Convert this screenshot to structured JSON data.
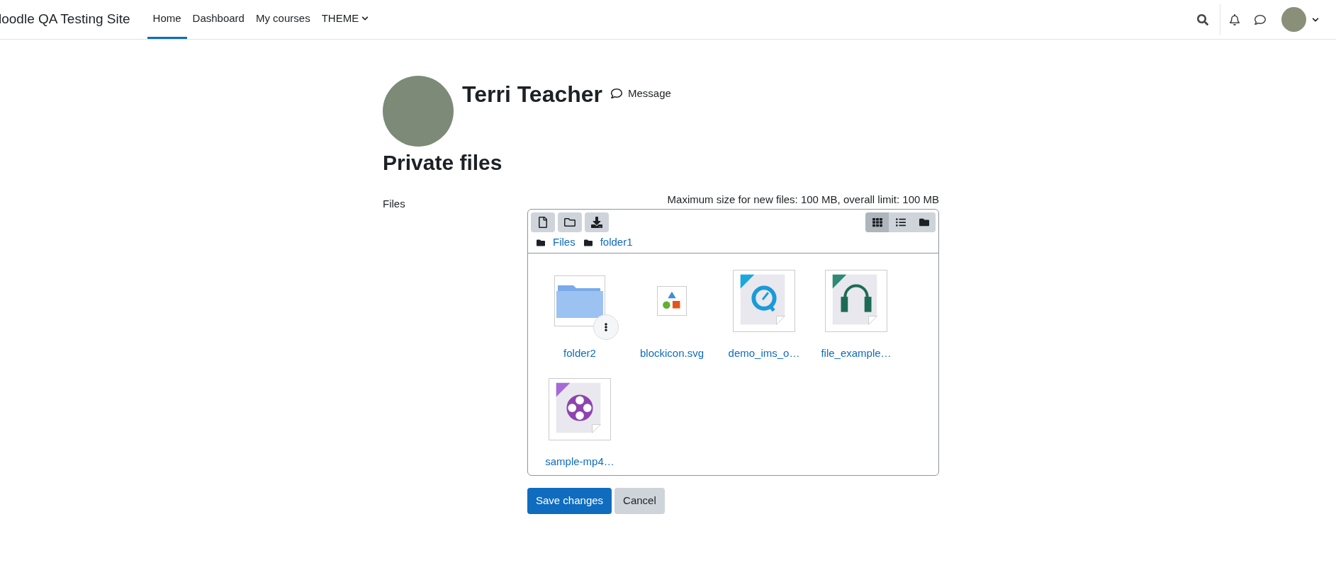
{
  "navbar": {
    "site_name": "loodle QA Testing Site",
    "links": [
      {
        "label": "Home",
        "selected": true,
        "dropdown": false
      },
      {
        "label": "Dashboard",
        "selected": false,
        "dropdown": false
      },
      {
        "label": "My courses",
        "selected": false,
        "dropdown": false
      },
      {
        "label": "THEME",
        "selected": false,
        "dropdown": true
      }
    ]
  },
  "profile": {
    "name": "Terri Teacher",
    "message_link": "Message"
  },
  "page_title": "Private files",
  "form": {
    "label": "Files",
    "limit_note": "Maximum size for new files: 100 MB, overall limit: 100 MB",
    "view_modes": [
      {
        "kind": "icons",
        "selected": true
      },
      {
        "kind": "list",
        "selected": false
      },
      {
        "kind": "tree",
        "selected": false
      }
    ],
    "breadcrumb": [
      "Files",
      "folder1"
    ],
    "files": [
      {
        "name": "folder2",
        "kind": "folder"
      },
      {
        "name": "blockicon.svg",
        "kind": "image"
      },
      {
        "name": "demo_ims_o…",
        "kind": "quicktime"
      },
      {
        "name": "file_example…",
        "kind": "audio"
      },
      {
        "name": "sample-mp4…",
        "kind": "mp4"
      }
    ],
    "buttons": [
      {
        "label": "Save changes",
        "kind": "primary"
      },
      {
        "label": "Cancel",
        "kind": "secondary"
      }
    ]
  }
}
